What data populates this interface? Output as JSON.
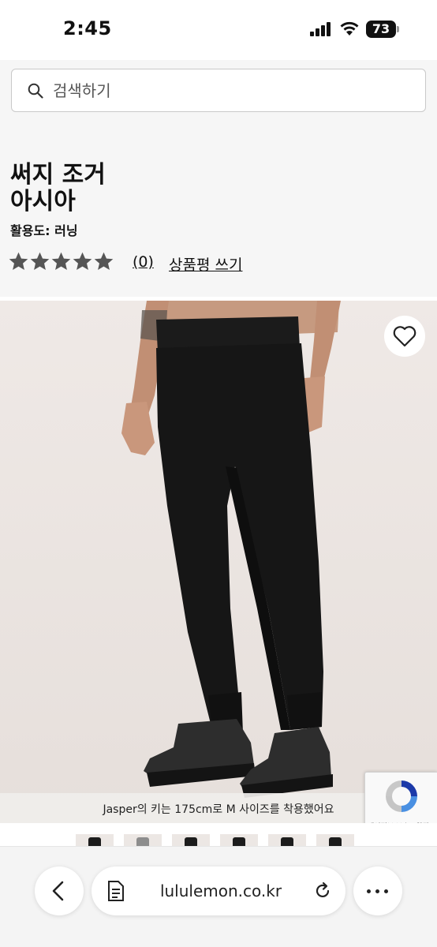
{
  "status_bar": {
    "time": "2:45",
    "battery": "73"
  },
  "search": {
    "placeholder": "검색하기"
  },
  "product": {
    "title_line1": "써지 조거",
    "title_line2": "아시아",
    "activity": "활용도: 러닝",
    "rating_stars": 5,
    "rating_value": 0,
    "review_count": "(0)",
    "write_review": "상품평 쓰기",
    "model_caption": "Jasper의 키는 175cm로 M 사이즈를 착용했어요"
  },
  "recaptcha": {
    "footer": "개인정보 보호 - 약관"
  },
  "browser": {
    "url": "lululemon.co.kr"
  },
  "colors": {
    "hero_background": "#ece6e3",
    "star_color": "#555555",
    "text": "#111111"
  },
  "icons": [
    "search-icon",
    "star-icon",
    "heart-icon",
    "back-icon",
    "reader-icon",
    "reload-icon",
    "more-icon",
    "recaptcha-icon",
    "signal-icon",
    "wifi-icon",
    "battery-icon"
  ]
}
